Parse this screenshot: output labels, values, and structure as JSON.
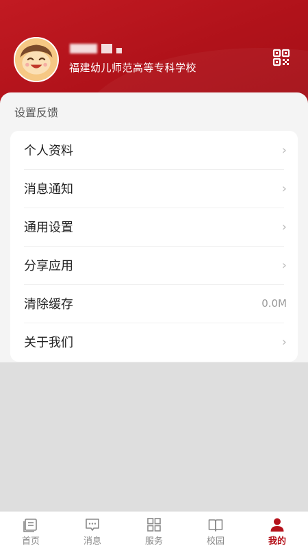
{
  "profile": {
    "school": "福建幼儿师范高等专科学校"
  },
  "settings": {
    "section_title": "设置反馈",
    "items": [
      {
        "label": "个人资料",
        "value": ""
      },
      {
        "label": "消息通知",
        "value": ""
      },
      {
        "label": "通用设置",
        "value": ""
      },
      {
        "label": "分享应用",
        "value": ""
      },
      {
        "label": "清除缓存",
        "value": "0.0M"
      },
      {
        "label": "关于我们",
        "value": ""
      }
    ],
    "chevron": "›"
  },
  "tabbar": {
    "tabs": [
      {
        "label": "首页",
        "icon": "home-icon"
      },
      {
        "label": "消息",
        "icon": "message-icon"
      },
      {
        "label": "服务",
        "icon": "grid-icon"
      },
      {
        "label": "校园",
        "icon": "book-icon"
      },
      {
        "label": "我的",
        "icon": "user-icon"
      }
    ],
    "active_index": 4
  },
  "colors": {
    "brand": "#b5121b",
    "header": "#a30f16"
  }
}
